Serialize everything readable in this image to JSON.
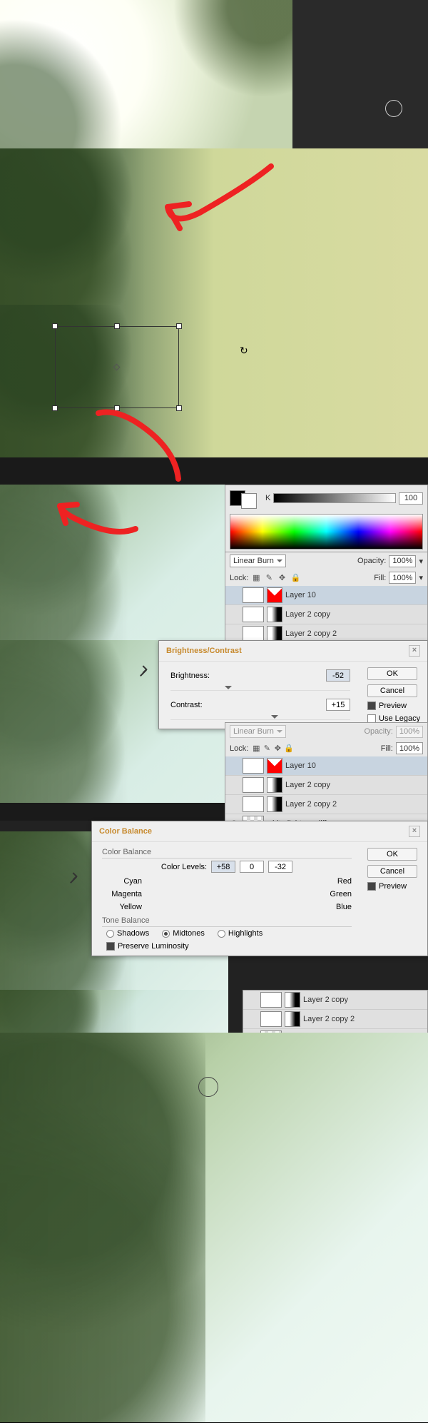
{
  "colorPanel": {
    "label_K": "K",
    "value_K": "100"
  },
  "layers": {
    "blendMode": "Linear Burn",
    "blendMode_disabled": "Linear Burn",
    "opacity_label": "Opacity:",
    "opacity_value": "100%",
    "fill_label": "Fill:",
    "fill_value": "100%",
    "lock_label": "Lock:",
    "items": [
      {
        "name": "Layer 10",
        "masked": true,
        "vis": false
      },
      {
        "name": "Layer 2 copy",
        "masked": false,
        "vis": false
      },
      {
        "name": "Layer 2 copy 2",
        "masked": false,
        "vis": false
      },
      {
        "name": "white light on cliff",
        "masked": false,
        "vis": true,
        "checker": true
      }
    ]
  },
  "brightness": {
    "title": "Brightness/Contrast",
    "brightness_label": "Brightness:",
    "brightness_value": "-52",
    "contrast_label": "Contrast:",
    "contrast_value": "+15",
    "ok": "OK",
    "cancel": "Cancel",
    "preview": "Preview",
    "legacy": "Use Legacy"
  },
  "colorbal": {
    "title": "Color Balance",
    "section_cb": "Color Balance",
    "section_tb": "Tone Balance",
    "levels_label": "Color Levels:",
    "v1": "+58",
    "v2": "0",
    "v3": "-32",
    "cyan": "Cyan",
    "red": "Red",
    "magenta": "Magenta",
    "green": "Green",
    "yellow": "Yellow",
    "blue": "Blue",
    "shadows": "Shadows",
    "midtones": "Midtones",
    "highlights": "Highlights",
    "preserve": "Preserve Luminosity",
    "ok": "OK",
    "cancel": "Cancel",
    "preview": "Preview"
  }
}
